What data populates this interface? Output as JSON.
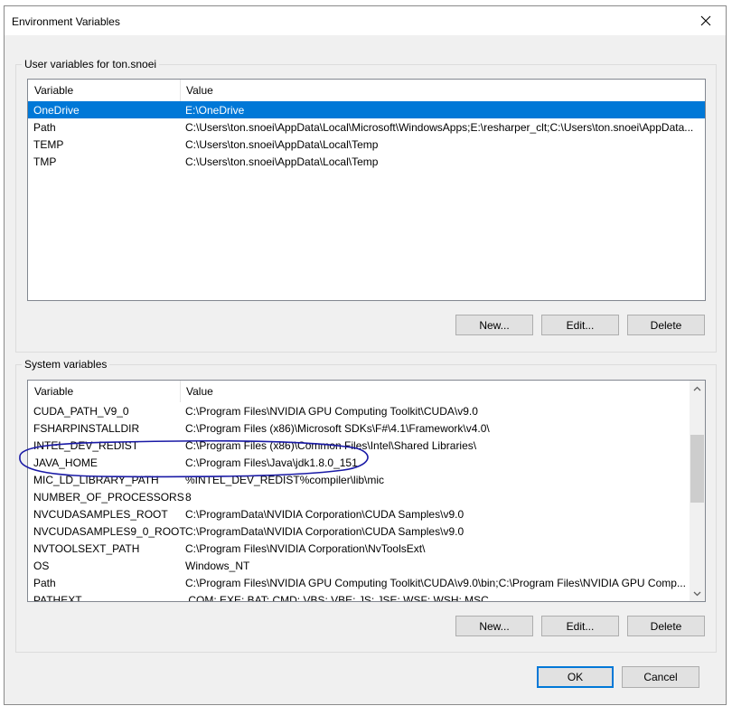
{
  "window": {
    "title": "Environment Variables",
    "close_icon": "close-icon"
  },
  "user_variables": {
    "group_label": "User variables for ton.snoei",
    "columns": [
      "Variable",
      "Value"
    ],
    "rows": [
      {
        "variable": "OneDrive",
        "value": "E:\\OneDrive",
        "selected": true
      },
      {
        "variable": "Path",
        "value": "C:\\Users\\ton.snoei\\AppData\\Local\\Microsoft\\WindowsApps;E:\\resharper_clt;C:\\Users\\ton.snoei\\AppData..."
      },
      {
        "variable": "TEMP",
        "value": "C:\\Users\\ton.snoei\\AppData\\Local\\Temp"
      },
      {
        "variable": "TMP",
        "value": "C:\\Users\\ton.snoei\\AppData\\Local\\Temp"
      }
    ],
    "buttons": {
      "new": "New...",
      "edit": "Edit...",
      "delete": "Delete"
    }
  },
  "system_variables": {
    "group_label": "System variables",
    "columns": [
      "Variable",
      "Value"
    ],
    "rows": [
      {
        "variable": "CUDA_PATH_V9_0",
        "value": "C:\\Program Files\\NVIDIA GPU Computing Toolkit\\CUDA\\v9.0"
      },
      {
        "variable": "FSHARPINSTALLDIR",
        "value": "C:\\Program Files (x86)\\Microsoft SDKs\\F#\\4.1\\Framework\\v4.0\\"
      },
      {
        "variable": "INTEL_DEV_REDIST",
        "value": "C:\\Program Files (x86)\\Common Files\\Intel\\Shared Libraries\\"
      },
      {
        "variable": "JAVA_HOME",
        "value": "C:\\Program Files\\Java\\jdk1.8.0_151"
      },
      {
        "variable": "MIC_LD_LIBRARY_PATH",
        "value": "%INTEL_DEV_REDIST%compiler\\lib\\mic"
      },
      {
        "variable": "NUMBER_OF_PROCESSORS",
        "value": "8"
      },
      {
        "variable": "NVCUDASAMPLES_ROOT",
        "value": "C:\\ProgramData\\NVIDIA Corporation\\CUDA Samples\\v9.0"
      },
      {
        "variable": "NVCUDASAMPLES9_0_ROOT",
        "value": "C:\\ProgramData\\NVIDIA Corporation\\CUDA Samples\\v9.0"
      },
      {
        "variable": "NVTOOLSEXT_PATH",
        "value": "C:\\Program Files\\NVIDIA Corporation\\NvToolsExt\\"
      },
      {
        "variable": "OS",
        "value": "Windows_NT"
      },
      {
        "variable": "Path",
        "value": "C:\\Program Files\\NVIDIA GPU Computing Toolkit\\CUDA\\v9.0\\bin;C:\\Program Files\\NVIDIA GPU Comp..."
      },
      {
        "variable": "PATHEXT",
        "value": ".COM;.EXE;.BAT;.CMD;.VBS;.VBE;.JS;.JSE;.WSF;.WSH;.MSC"
      }
    ],
    "scroll_up_icon": "chevron-up-icon",
    "scroll_down_icon": "chevron-down-icon",
    "buttons": {
      "new": "New...",
      "edit": "Edit...",
      "delete": "Delete"
    }
  },
  "footer": {
    "ok": "OK",
    "cancel": "Cancel"
  },
  "colors": {
    "selection": "#0078d7",
    "annotation": "#1a1aa6"
  }
}
